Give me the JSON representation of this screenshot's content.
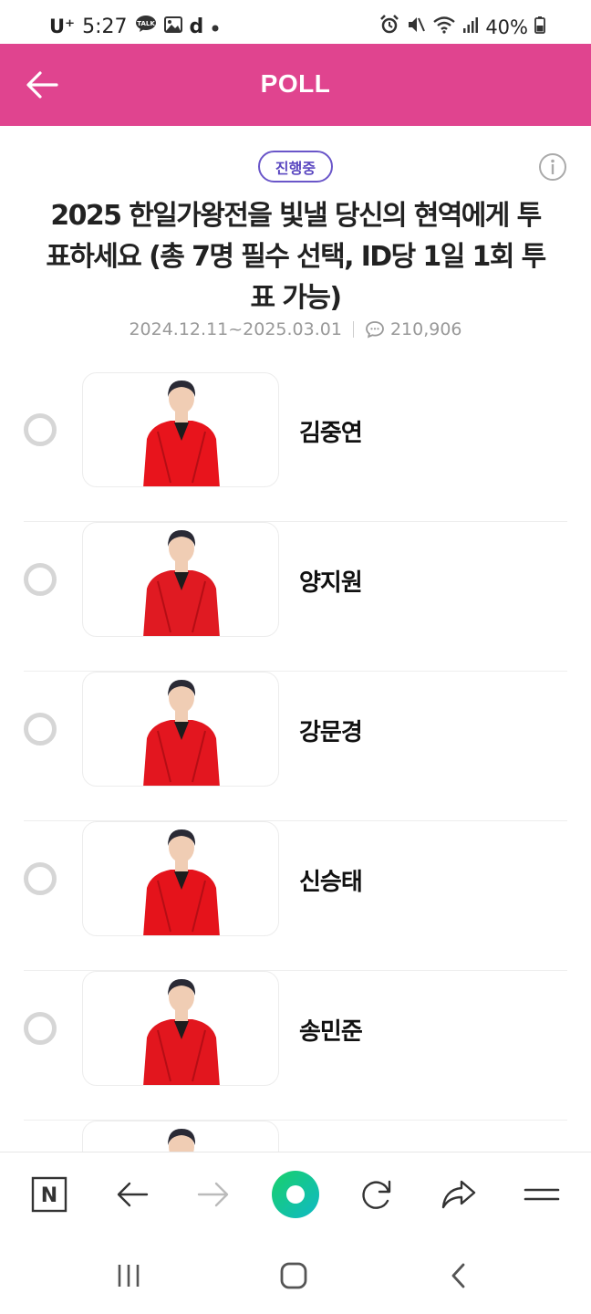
{
  "status_bar": {
    "carrier": "U⁺",
    "time": "5:27",
    "app_icons": [
      "kakaotalk-icon",
      "gallery-icon",
      "d-icon",
      "dot-icon"
    ],
    "kakao_label": "TALK",
    "d_label": "d",
    "system_icons": [
      "alarm-icon",
      "mute-icon",
      "wifi-icon",
      "signal-icon",
      "battery-icon"
    ],
    "battery": "40%"
  },
  "header": {
    "title": "POLL",
    "background_color": "#e0448f"
  },
  "poll": {
    "status_badge": "진행중",
    "title": "2025 한일가왕전을 빛낼 당신의 현역에게 투표하세요 (총 7명 필수 선택, ID당 1일 1회 투표 가능)",
    "period": "2024.12.11~2025.03.01",
    "comment_count": "210,906"
  },
  "candidates": [
    {
      "name": "김중연",
      "outfit_color": "#e8141c"
    },
    {
      "name": "양지원",
      "outfit_color": "#e01a22"
    },
    {
      "name": "강문경",
      "outfit_color": "#e3161f"
    },
    {
      "name": "신승태",
      "outfit_color": "#e5131b"
    },
    {
      "name": "송민준",
      "outfit_color": "#e2161e"
    },
    {
      "name": "",
      "outfit_color": "#e2161e"
    }
  ],
  "browser_toolbar": {
    "items": [
      "naver-home-icon",
      "back-arrow-icon",
      "forward-arrow-icon",
      "green-dot-icon",
      "refresh-icon",
      "share-icon",
      "menu-icon"
    ],
    "home_label": "N"
  },
  "android_nav": {
    "items": [
      "recent-apps-icon",
      "home-icon",
      "back-icon"
    ]
  }
}
